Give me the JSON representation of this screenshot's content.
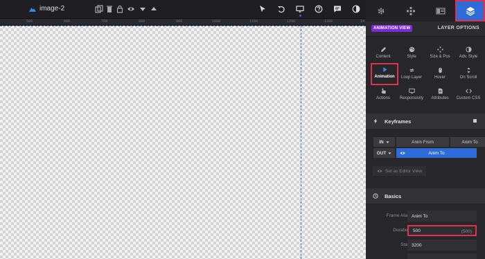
{
  "toolbar": {
    "layer_name": "image-2",
    "icons": [
      "mountain-icon",
      "copy-icon",
      "trash-icon",
      "lock-icon",
      "eye-icon",
      "arrow-down-icon",
      "arrow-up-icon",
      "cursor-icon",
      "undo-icon",
      "desktop-icon",
      "help-icon",
      "comment-icon",
      "contrast-icon"
    ]
  },
  "ruler": {
    "labels": [
      "500",
      "600",
      "700",
      "800",
      "900",
      "1000",
      "1100",
      "1200",
      "1300",
      "14"
    ]
  },
  "panel_tabs": {
    "icons": [
      "gear-icon",
      "move-icon",
      "layers-rows-icon",
      "layers-icon"
    ],
    "active_index": 3
  },
  "panel_header": {
    "animation_view": "ANIMATION VIEW",
    "layer_options": "LAYER OPTIONS"
  },
  "options_grid": [
    {
      "label": "Content",
      "icon": "pencil-icon"
    },
    {
      "label": "Style",
      "icon": "palette-icon"
    },
    {
      "label": "Size & Pos",
      "icon": "move-icon"
    },
    {
      "label": "Adv. Style",
      "icon": "contrast-icon"
    },
    {
      "label": "Animation",
      "icon": "play-icon",
      "selected": true
    },
    {
      "label": "Loop Layer",
      "icon": "loop-icon"
    },
    {
      "label": "Hover",
      "icon": "mouse-icon"
    },
    {
      "label": "On Scroll",
      "icon": "scroll-icon"
    },
    {
      "label": "Actions",
      "icon": "hand-icon"
    },
    {
      "label": "Responsivity",
      "icon": "monitor-icon"
    },
    {
      "label": "Attributes",
      "icon": "file-icon"
    },
    {
      "label": "Custom CSS",
      "icon": "code-icon"
    }
  ],
  "keyframes": {
    "title": "Keyframes",
    "in_label": "IN",
    "out_label": "OUT",
    "anim_from": "Anim From",
    "anim_to": "Anim To",
    "anim_to_active": "Anim To",
    "set_editor_view": "Set as Editor View"
  },
  "basics": {
    "title": "Basics",
    "frame_alias_label": "Frame Alias",
    "frame_alias_value": "Anim To",
    "duration_label": "Duration",
    "duration_value": "500",
    "duration_hint": "(500)",
    "start_label": "Start",
    "start_value": "3200"
  },
  "colors": {
    "accent": "#2f6bd8",
    "highlight": "#e0334a",
    "badge": "#7a2bd6"
  }
}
